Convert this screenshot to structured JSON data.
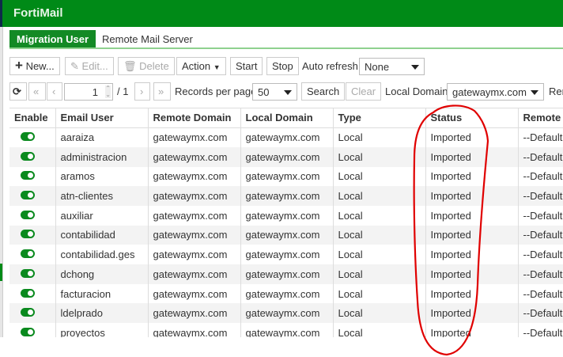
{
  "app": {
    "title": "FortiMail"
  },
  "tabs": [
    {
      "label": "Migration User"
    },
    {
      "label": "Remote Mail Server"
    }
  ],
  "toolbar": {
    "new": "New...",
    "edit": "Edit...",
    "delete": "Delete",
    "action": "Action",
    "start": "Start",
    "stop": "Stop",
    "auto_refresh_label": "Auto refresh",
    "auto_refresh_value": "None"
  },
  "pager": {
    "page": "1",
    "total": "/ 1",
    "records_label": "Records per page",
    "records_value": "50",
    "search": "Search",
    "clear": "Clear",
    "local_domain_label": "Local Domain",
    "local_domain_value": "gatewaymx.com",
    "rem": "Rem"
  },
  "table": {
    "headers": [
      "Enable",
      "Email User",
      "Remote Domain",
      "Local Domain",
      "Type",
      "Status",
      "Remote S"
    ],
    "rows": [
      [
        "aaraiza",
        "gatewaymx.com",
        "gatewaymx.com",
        "Local",
        "Imported",
        "--Default-"
      ],
      [
        "administracion",
        "gatewaymx.com",
        "gatewaymx.com",
        "Local",
        "Imported",
        "--Default-"
      ],
      [
        "aramos",
        "gatewaymx.com",
        "gatewaymx.com",
        "Local",
        "Imported",
        "--Default-"
      ],
      [
        "atn-clientes",
        "gatewaymx.com",
        "gatewaymx.com",
        "Local",
        "Imported",
        "--Default-"
      ],
      [
        "auxiliar",
        "gatewaymx.com",
        "gatewaymx.com",
        "Local",
        "Imported",
        "--Default-"
      ],
      [
        "contabilidad",
        "gatewaymx.com",
        "gatewaymx.com",
        "Local",
        "Imported",
        "--Default-"
      ],
      [
        "contabilidad.ges",
        "gatewaymx.com",
        "gatewaymx.com",
        "Local",
        "Imported",
        "--Default-"
      ],
      [
        "dchong",
        "gatewaymx.com",
        "gatewaymx.com",
        "Local",
        "Imported",
        "--Default-"
      ],
      [
        "facturacion",
        "gatewaymx.com",
        "gatewaymx.com",
        "Local",
        "Imported",
        "--Default-"
      ],
      [
        "ldelprado",
        "gatewaymx.com",
        "gatewaymx.com",
        "Local",
        "Imported",
        "--Default-"
      ],
      [
        "proyectos",
        "gatewaymx.com",
        "gatewaymx.com",
        "Local",
        "Imported",
        "--Default-"
      ]
    ]
  },
  "colors": {
    "brand": "#008a17",
    "annotation": "#e00000"
  }
}
